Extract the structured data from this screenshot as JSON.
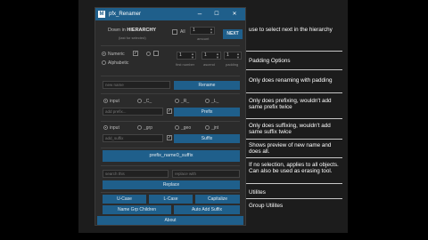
{
  "window": {
    "title": "pfx_Renamer",
    "app_icon": "M",
    "minimize": "–",
    "maximize": "☐",
    "close": "✕"
  },
  "selection": {
    "line1_prefix": "Down in ",
    "line1_strong": "HIERARCHY",
    "line2": "(last for selected)",
    "all_label": "All",
    "amount_value": "1",
    "amount_label": "amount",
    "next_label": "NEXT"
  },
  "padding": {
    "numeric_label": "Numeric",
    "alphabetic_label": "Alphabetic",
    "field1": "1",
    "field2": "1",
    "field3": "1",
    "sublabel1": "first number",
    "sublabel2": "ascend",
    "sublabel3": "padding"
  },
  "rename": {
    "placeholder": "new name",
    "button": "Rename"
  },
  "prefix": {
    "radio_labels": [
      "input",
      "_C_",
      "_R_",
      "_L_"
    ],
    "placeholder": "add prefix...",
    "button": "Prefix"
  },
  "suffix": {
    "radio_labels": [
      "input",
      "_grp",
      "_geo",
      "_jnt"
    ],
    "placeholder": "add_suffix",
    "button": "Suffix"
  },
  "preview": {
    "text": "prefix_name0_suffix"
  },
  "replace": {
    "search_placeholder": "search this",
    "replace_placeholder": "replace with",
    "button": "Replace"
  },
  "utilities": {
    "ucase": "U-Case",
    "lcase": "L-Case",
    "capitalize": "Capitalize"
  },
  "group_utilities": {
    "name_grp_children": "Name Grp Children",
    "auto_add_suffix": "Auto Add Suffix"
  },
  "about": "About",
  "notes": [
    "use to select next in the hierarchy",
    "Padding Options",
    "Only does renaming with padding",
    "Only does prefixing, wouldn't add same prefix twice",
    "Only does suffixing, wouldn't add same suffix twice",
    "Shows preview of new name and does all.",
    "If no selection, applies to all objects. Can also be used as erasing tool.",
    "Utilites",
    "Group Utilites"
  ]
}
